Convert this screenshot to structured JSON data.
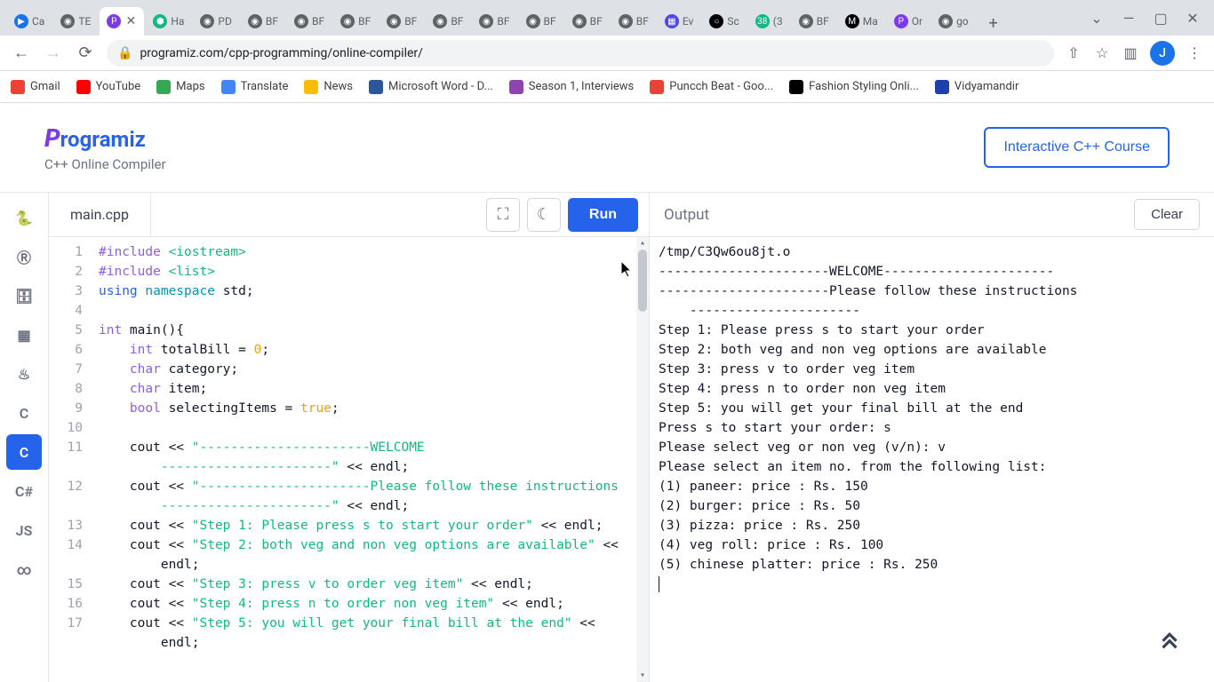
{
  "browser": {
    "tabs": [
      {
        "icon_bg": "#1a73e8",
        "icon_fg": "#fff",
        "glyph": "▶",
        "label": "Ca"
      },
      {
        "icon_bg": "#5f6368",
        "icon_fg": "#fff",
        "glyph": "◉",
        "label": "TE"
      },
      {
        "icon_bg": "#7c3aed",
        "icon_fg": "#fff",
        "glyph": "P",
        "label": "",
        "active": true,
        "close": true
      },
      {
        "icon_bg": "#10b981",
        "icon_fg": "#fff",
        "glyph": "⬢",
        "label": "Ha"
      },
      {
        "icon_bg": "#5f6368",
        "icon_fg": "#fff",
        "glyph": "◉",
        "label": "PD"
      },
      {
        "icon_bg": "#5f6368",
        "icon_fg": "#fff",
        "glyph": "◉",
        "label": "BF"
      },
      {
        "icon_bg": "#5f6368",
        "icon_fg": "#fff",
        "glyph": "◉",
        "label": "BF"
      },
      {
        "icon_bg": "#5f6368",
        "icon_fg": "#fff",
        "glyph": "◉",
        "label": "BF"
      },
      {
        "icon_bg": "#5f6368",
        "icon_fg": "#fff",
        "glyph": "◉",
        "label": "BF"
      },
      {
        "icon_bg": "#5f6368",
        "icon_fg": "#fff",
        "glyph": "◉",
        "label": "BF"
      },
      {
        "icon_bg": "#5f6368",
        "icon_fg": "#fff",
        "glyph": "◉",
        "label": "BF"
      },
      {
        "icon_bg": "#5f6368",
        "icon_fg": "#fff",
        "glyph": "◉",
        "label": "BF"
      },
      {
        "icon_bg": "#5f6368",
        "icon_fg": "#fff",
        "glyph": "◉",
        "label": "BF"
      },
      {
        "icon_bg": "#5f6368",
        "icon_fg": "#fff",
        "glyph": "◉",
        "label": "BF"
      },
      {
        "icon_bg": "#4f46e5",
        "icon_fg": "#fff",
        "glyph": "▦",
        "label": "Ev"
      },
      {
        "icon_bg": "#000",
        "icon_fg": "#fff",
        "glyph": "○",
        "label": "Sc"
      },
      {
        "icon_bg": "#10b981",
        "icon_fg": "#fff",
        "glyph": "38",
        "label": "(3"
      },
      {
        "icon_bg": "#5f6368",
        "icon_fg": "#fff",
        "glyph": "◉",
        "label": "BF"
      },
      {
        "icon_bg": "#000",
        "icon_fg": "#fff",
        "glyph": "M",
        "label": "Ma"
      },
      {
        "icon_bg": "#7c3aed",
        "icon_fg": "#fff",
        "glyph": "P",
        "label": "Or"
      },
      {
        "icon_bg": "#5f6368",
        "icon_fg": "#fff",
        "glyph": "◉",
        "label": "go"
      }
    ],
    "url": "programiz.com/cpp-programming/online-compiler/",
    "profile_letter": "J",
    "bookmarks": [
      {
        "bg": "#ea4335",
        "label": "Gmail"
      },
      {
        "bg": "#ff0000",
        "label": "YouTube"
      },
      {
        "bg": "#34a853",
        "label": "Maps"
      },
      {
        "bg": "#4285f4",
        "label": "Translate"
      },
      {
        "bg": "#fbbc04",
        "label": "News"
      },
      {
        "bg": "#2b579a",
        "label": "Microsoft Word - D..."
      },
      {
        "bg": "#8e44ad",
        "label": "Season 1, Interviews"
      },
      {
        "bg": "#ea4335",
        "label": "Puncch Beat - Goo..."
      },
      {
        "bg": "#000",
        "label": "Fashion Styling Onli..."
      },
      {
        "bg": "#1e40af",
        "label": "Vidyamandir"
      }
    ]
  },
  "page": {
    "logo": "Programiz",
    "subtitle": "C++ Online Compiler",
    "course_btn": "Interactive C++ Course"
  },
  "sidebar": {
    "langs": [
      "py",
      "R",
      "db",
      "html",
      "java",
      "c",
      "cpp",
      "cs",
      "JS",
      "go"
    ]
  },
  "editor": {
    "filename": "main.cpp",
    "run_label": "Run",
    "gutter": [
      "1",
      "2",
      "3",
      "4",
      "5",
      "6",
      "7",
      "8",
      "9",
      "10",
      "11",
      "",
      "12",
      "",
      "13",
      "14",
      "",
      "15",
      "16",
      "17",
      ""
    ],
    "lines": [
      [
        [
          "pp",
          "#include "
        ],
        [
          "inc",
          "<iostream>"
        ]
      ],
      [
        [
          "pp",
          "#include "
        ],
        [
          "inc",
          "<list>"
        ]
      ],
      [
        [
          "kw",
          "using "
        ],
        [
          "ns",
          "namespace"
        ],
        [
          "",
          " std;"
        ]
      ],
      [
        [
          "",
          ""
        ]
      ],
      [
        [
          "type",
          "int "
        ],
        [
          "",
          "main(){"
        ]
      ],
      [
        [
          "",
          "    "
        ],
        [
          "type",
          "int "
        ],
        [
          "",
          "totalBill = "
        ],
        [
          "num",
          "0"
        ],
        [
          "",
          ";"
        ]
      ],
      [
        [
          "",
          "    "
        ],
        [
          "type",
          "char "
        ],
        [
          "",
          "category;"
        ]
      ],
      [
        [
          "",
          "    "
        ],
        [
          "type",
          "char "
        ],
        [
          "",
          "item;"
        ]
      ],
      [
        [
          "",
          "    "
        ],
        [
          "type",
          "bool "
        ],
        [
          "",
          "selectingItems = "
        ],
        [
          "bool",
          "true"
        ],
        [
          "",
          ";"
        ]
      ],
      [
        [
          "",
          ""
        ]
      ],
      [
        [
          "",
          "    cout << "
        ],
        [
          "str",
          "\"----------------------WELCOME"
        ]
      ],
      [
        [
          "",
          "        "
        ],
        [
          "str",
          "----------------------\""
        ],
        [
          "",
          " << endl;"
        ]
      ],
      [
        [
          "",
          "    cout << "
        ],
        [
          "str",
          "\"----------------------Please follow these instructions"
        ]
      ],
      [
        [
          "",
          "        "
        ],
        [
          "str",
          "----------------------\""
        ],
        [
          "",
          " << endl;"
        ]
      ],
      [
        [
          "",
          "    cout << "
        ],
        [
          "str",
          "\"Step 1: Please press s to start your order\""
        ],
        [
          "",
          " << endl;"
        ]
      ],
      [
        [
          "",
          "    cout << "
        ],
        [
          "str",
          "\"Step 2: both veg and non veg options are available\""
        ],
        [
          "",
          " <<"
        ]
      ],
      [
        [
          "",
          "        endl;"
        ]
      ],
      [
        [
          "",
          "    cout << "
        ],
        [
          "str",
          "\"Step 3: press v to order veg item\""
        ],
        [
          "",
          " << endl;"
        ]
      ],
      [
        [
          "",
          "    cout << "
        ],
        [
          "str",
          "\"Step 4: press n to order non veg item\""
        ],
        [
          "",
          " << endl;"
        ]
      ],
      [
        [
          "",
          "    cout << "
        ],
        [
          "str",
          "\"Step 5: you will get your final bill at the end\""
        ],
        [
          "",
          " <<"
        ]
      ],
      [
        [
          "",
          "        endl;"
        ]
      ]
    ]
  },
  "output": {
    "title": "Output",
    "clear_label": "Clear",
    "lines": [
      "/tmp/C3Qw6ou8jt.o",
      "----------------------WELCOME----------------------",
      "----------------------Please follow these instructions ",
      "    ----------------------",
      "Step 1: Please press s to start your order",
      "Step 2: both veg and non veg options are available",
      "Step 3: press v to order veg item",
      "Step 4: press n to order non veg item",
      "Step 5: you will get your final bill at the end",
      "Press s to start your order: s",
      "Please select veg or non veg (v/n): v",
      "Please select an item no. from the following list:",
      "(1) paneer: price : Rs. 150",
      "(2) burger: price : Rs. 50",
      "(3) pizza: price : Rs. 250",
      "(4) veg roll: price : Rs. 100",
      "(5) chinese platter: price : Rs. 250"
    ]
  }
}
